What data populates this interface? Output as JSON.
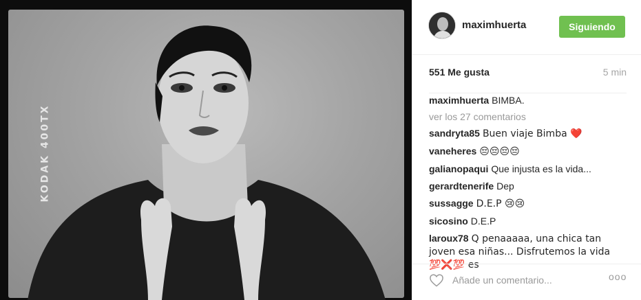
{
  "photo": {
    "edge_text": "KODAK 400TX"
  },
  "header": {
    "username": "maximhuerta",
    "follow_label": "Siguiendo"
  },
  "stats": {
    "likes": "551 Me gusta",
    "time": "5 min"
  },
  "caption": {
    "user": "maximhuerta",
    "text": "BIMBA."
  },
  "view_all": "ver los 27 comentarios",
  "comments": [
    {
      "user": "sandryta85",
      "text": "Buen viaje Bimba ❤️"
    },
    {
      "user": "vaneheres",
      "text": "😔😔😔😔"
    },
    {
      "user": "galianopaqui",
      "text": "Que injusta es la vida..."
    },
    {
      "user": "gerardtenerife",
      "text": "Dep"
    },
    {
      "user": "sussagge",
      "text": "D.E.P 😢😢"
    },
    {
      "user": "sicosino",
      "text": "D.E.P"
    },
    {
      "user": "laroux78",
      "text": "Q penaaaaa, una chica tan joven esa niñas... Disfrutemos la vida 💯❌💯 es"
    }
  ],
  "footer": {
    "comment_placeholder": "Añade un comentario...",
    "more_label": "ooo"
  },
  "colors": {
    "follow_green": "#70c050",
    "muted_grey": "#999999"
  }
}
